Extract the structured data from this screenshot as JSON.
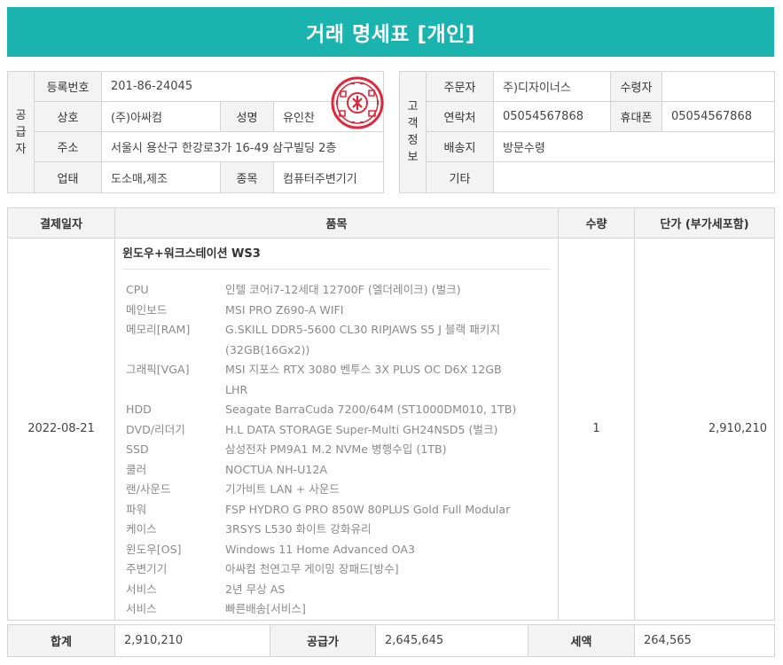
{
  "title": "거래 명세표 [개인]",
  "supplier": {
    "side_label": "공\n급\n자",
    "reg_no_label": "등록번호",
    "reg_no": "201-86-24045",
    "company_label": "상호",
    "company": "(주)아싸컴",
    "name_label": "성명",
    "name": "유인찬",
    "address_label": "주소",
    "address": "서울시 용산구 한강로3가 16-49 삼구빌딩 2층",
    "business_label": "업태",
    "business": "도소매,제조",
    "item_label": "종목",
    "item": "컴퓨터주변기기",
    "seal_text": "(주)아싸컴"
  },
  "customer": {
    "side_label": "고\n객\n정\n보",
    "orderer_label": "주문자",
    "orderer": "주)디자이너스",
    "recipient_label": "수령자",
    "recipient": "",
    "contact_label": "연락처",
    "contact": "05054567868",
    "mobile_label": "휴대폰",
    "mobile": "05054567868",
    "delivery_label": "배송지",
    "delivery": "방문수령",
    "etc_label": "기타",
    "etc": ""
  },
  "items_table": {
    "headers": [
      "결제일자",
      "품목",
      "수량",
      "단가 (부가세포함)"
    ],
    "date": "2022-08-21",
    "product_name": "윈도우+워크스테이션 WS3",
    "specs": [
      {
        "k": "CPU",
        "v": "인텔 코어i7-12세대 12700F (엘더레이크) (벌크)"
      },
      {
        "k": "메인보드",
        "v": "MSI PRO Z690-A WIFI"
      },
      {
        "k": "메모리[RAM]",
        "v": "G.SKILL DDR5-5600 CL30 RIPJAWS S5 J 블랙 패키지 (32GB(16Gx2))"
      },
      {
        "k": "그래픽[VGA]",
        "v": "MSI 지포스 RTX 3080 벤투스 3X PLUS OC D6X 12GB LHR"
      },
      {
        "k": "HDD",
        "v": "Seagate BarraCuda 7200/64M (ST1000DM010, 1TB)"
      },
      {
        "k": "DVD/리더기",
        "v": "H.L DATA STORAGE Super-Multi GH24NSD5 (벌크)"
      },
      {
        "k": "SSD",
        "v": "삼성전자 PM9A1 M.2 NVMe 병행수입 (1TB)"
      },
      {
        "k": "쿨러",
        "v": "NOCTUA NH-U12A"
      },
      {
        "k": "랜/사운드",
        "v": "기가비트 LAN + 사운드"
      },
      {
        "k": "파워",
        "v": "FSP HYDRO G PRO 850W 80PLUS Gold Full Modular"
      },
      {
        "k": "케이스",
        "v": "3RSYS L530 화이트 강화유리"
      },
      {
        "k": "윈도우[OS]",
        "v": "Windows 11 Home Advanced OA3"
      },
      {
        "k": "주변기기",
        "v": "아싸컴 천연고무 게이밍 장패드[방수]"
      },
      {
        "k": "서비스",
        "v": "2년 무상 AS"
      },
      {
        "k": "서비스",
        "v": "빠른배송[서비스]"
      }
    ],
    "quantity": "1",
    "unit_price": "2,910,210"
  },
  "totals": {
    "total_label": "합계",
    "total": "2,910,210",
    "supply_label": "공급가",
    "supply": "2,645,645",
    "tax_label": "세액",
    "tax": "264,565"
  },
  "colors": {
    "header_bg": "#1ab3ad",
    "seal": "#e0263a"
  }
}
